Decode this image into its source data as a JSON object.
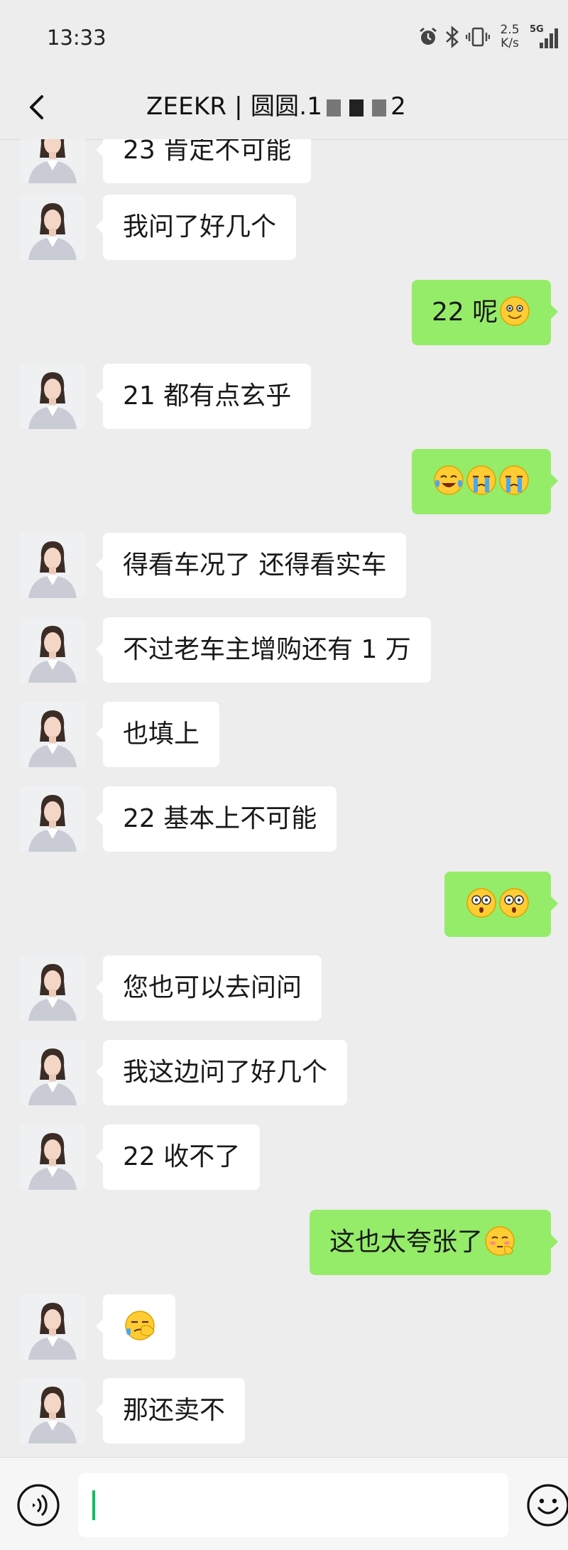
{
  "status": {
    "time": "13:33",
    "speed_top": "2.5",
    "speed_bottom": "K/s",
    "network": "5G"
  },
  "header": {
    "title_prefix": "ZEEKR | 圆圆.1",
    "title_suffix": "2"
  },
  "messages": [
    {
      "side": "left",
      "text": "23 肯定不可能",
      "emojis": []
    },
    {
      "side": "left",
      "text": "我问了好几个",
      "emojis": []
    },
    {
      "side": "right",
      "text": "22 呢",
      "emojis": [
        "smile-emoji"
      ]
    },
    {
      "side": "left",
      "text": "21 都有点玄乎",
      "emojis": []
    },
    {
      "side": "right",
      "text": "",
      "emojis": [
        "tears-of-joy-emoji",
        "crying-emoji",
        "crying-emoji"
      ]
    },
    {
      "side": "left",
      "text": "得看车况了  还得看实车",
      "emojis": []
    },
    {
      "side": "left",
      "text": "不过老车主增购还有 1 万",
      "emojis": []
    },
    {
      "side": "left",
      "text": "也填上",
      "emojis": []
    },
    {
      "side": "left",
      "text": "22 基本上不可能",
      "emojis": []
    },
    {
      "side": "right",
      "text": "",
      "emojis": [
        "shocked-emoji",
        "shocked-emoji"
      ]
    },
    {
      "side": "left",
      "text": "您也可以去问问",
      "emojis": []
    },
    {
      "side": "left",
      "text": "我这边问了好几个",
      "emojis": []
    },
    {
      "side": "left",
      "text": "22 收不了",
      "emojis": []
    },
    {
      "side": "right",
      "text": "这也太夸张了",
      "emojis": [
        "shy-emoji"
      ]
    },
    {
      "side": "left",
      "text": "",
      "emojis": [
        "facepalm-emoji"
      ]
    },
    {
      "side": "left",
      "text": "那还卖不",
      "emojis": []
    }
  ],
  "input": {
    "value": ""
  },
  "icons": {
    "back": "chevron-left-icon",
    "voice": "voice-icon",
    "emoji": "emoji-icon"
  },
  "colors": {
    "background": "#ededed",
    "left_bubble": "#ffffff",
    "right_bubble": "#95ec69",
    "cursor": "#07c160"
  }
}
